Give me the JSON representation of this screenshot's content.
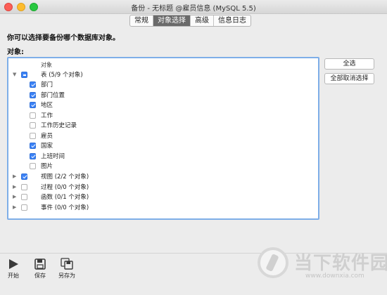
{
  "window": {
    "title": "备份 - 无标题 @雇员信息 (MySQL 5.5)"
  },
  "tabs": [
    {
      "label": "常规",
      "active": false
    },
    {
      "label": "对象选择",
      "active": true
    },
    {
      "label": "高级",
      "active": false
    },
    {
      "label": "信息日志",
      "active": false
    }
  ],
  "prompt": "你可以选择要备份哪个数据库对象。",
  "objects_label": "对象:",
  "tree": {
    "header": "对象",
    "tables": {
      "label": "表 (5/9 个对象)",
      "state": "mixed",
      "expanded": true
    },
    "items": [
      {
        "label": "部门",
        "checked": true
      },
      {
        "label": "部门位置",
        "checked": true
      },
      {
        "label": "地区",
        "checked": true
      },
      {
        "label": "工作",
        "checked": false
      },
      {
        "label": "工作历史记录",
        "checked": false
      },
      {
        "label": "雇员",
        "checked": false
      },
      {
        "label": "国家",
        "checked": true
      },
      {
        "label": "上班时间",
        "checked": true
      },
      {
        "label": "图片",
        "checked": false
      }
    ],
    "groups": [
      {
        "label": "视图 (2/2 个对象)",
        "state": "checked"
      },
      {
        "label": "过程 (0/0 个对象)",
        "state": "unchecked"
      },
      {
        "label": "函数 (0/1 个对象)",
        "state": "unchecked"
      },
      {
        "label": "事件 (0/0 个对象)",
        "state": "unchecked"
      }
    ]
  },
  "buttons": {
    "select_all": "全选",
    "deselect_all": "全部取消选择"
  },
  "toolbar": {
    "start": "开始",
    "save": "保存",
    "save_as": "另存为"
  },
  "watermark": {
    "text": "当下软件园",
    "url": "www.downxia.com"
  },
  "colors": {
    "accent": "#3b82f6",
    "tree_border": "#7eaee8",
    "active_tab": "#6a6a6a"
  }
}
